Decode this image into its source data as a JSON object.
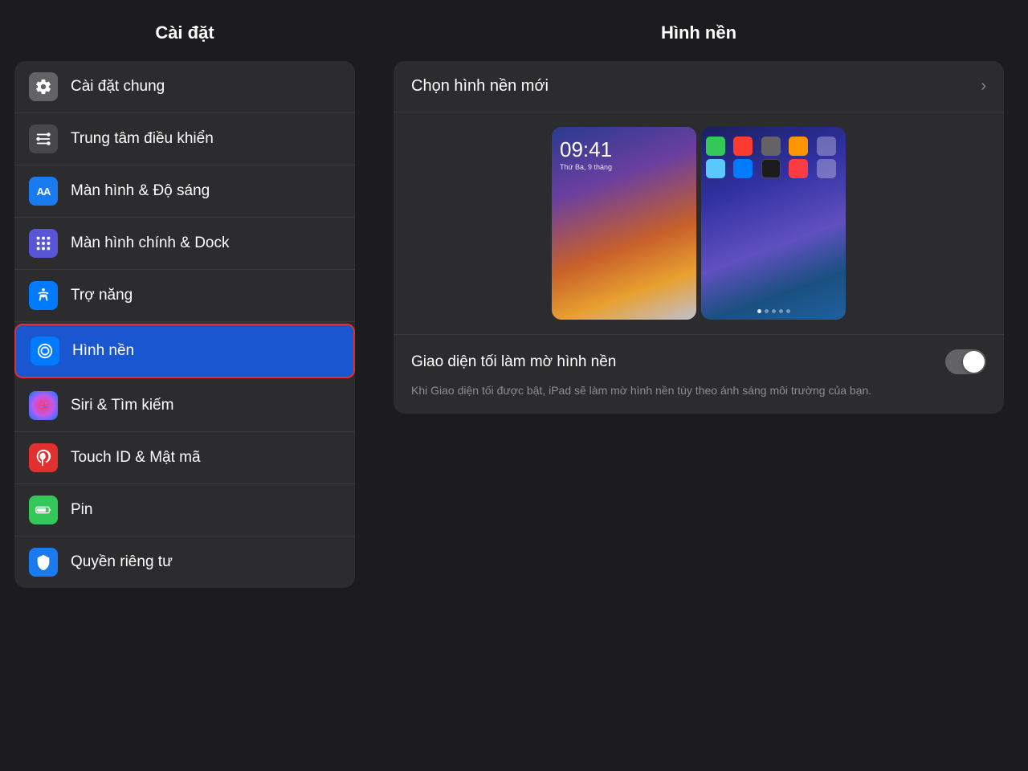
{
  "sidebar": {
    "title": "Cài đặt",
    "items": [
      {
        "id": "general",
        "label": "Cài đặt chung",
        "icon_type": "gear",
        "icon_bg": "gray"
      },
      {
        "id": "control-center",
        "label": "Trung tâm điều khiển",
        "icon_type": "sliders",
        "icon_bg": "gray2"
      },
      {
        "id": "display",
        "label": "Màn hình & Độ sáng",
        "icon_type": "AA",
        "icon_bg": "blue"
      },
      {
        "id": "home-dock",
        "label": "Màn hình chính & Dock",
        "icon_type": "grid",
        "icon_bg": "indigo"
      },
      {
        "id": "accessibility",
        "label": "Trợ năng",
        "icon_type": "person",
        "icon_bg": "blue2"
      },
      {
        "id": "wallpaper",
        "label": "Hình nền",
        "icon_type": "snowflake",
        "icon_bg": "blue3",
        "active": true
      },
      {
        "id": "siri",
        "label": "Siri & Tìm kiếm",
        "icon_type": "siri",
        "icon_bg": "siri"
      },
      {
        "id": "touchid",
        "label": "Touch ID & Mật mã",
        "icon_type": "fingerprint",
        "icon_bg": "touch"
      },
      {
        "id": "battery",
        "label": "Pin",
        "icon_type": "battery",
        "icon_bg": "green"
      },
      {
        "id": "privacy",
        "label": "Quyền riêng tư",
        "icon_type": "hand",
        "icon_bg": "blue4"
      }
    ]
  },
  "main": {
    "title": "Hình nền",
    "choose_label": "Chọn hình nền mới",
    "toggle_label": "Giao diện tối làm mờ hình nền",
    "toggle_state": false,
    "description": "Khi Giao diện tối được bật, iPad sẽ làm mờ hình nền tùy theo ánh sáng môi trường của bạn.",
    "preview_time": "09:41",
    "preview_date": "Thứ Ba, 9 tháng"
  }
}
